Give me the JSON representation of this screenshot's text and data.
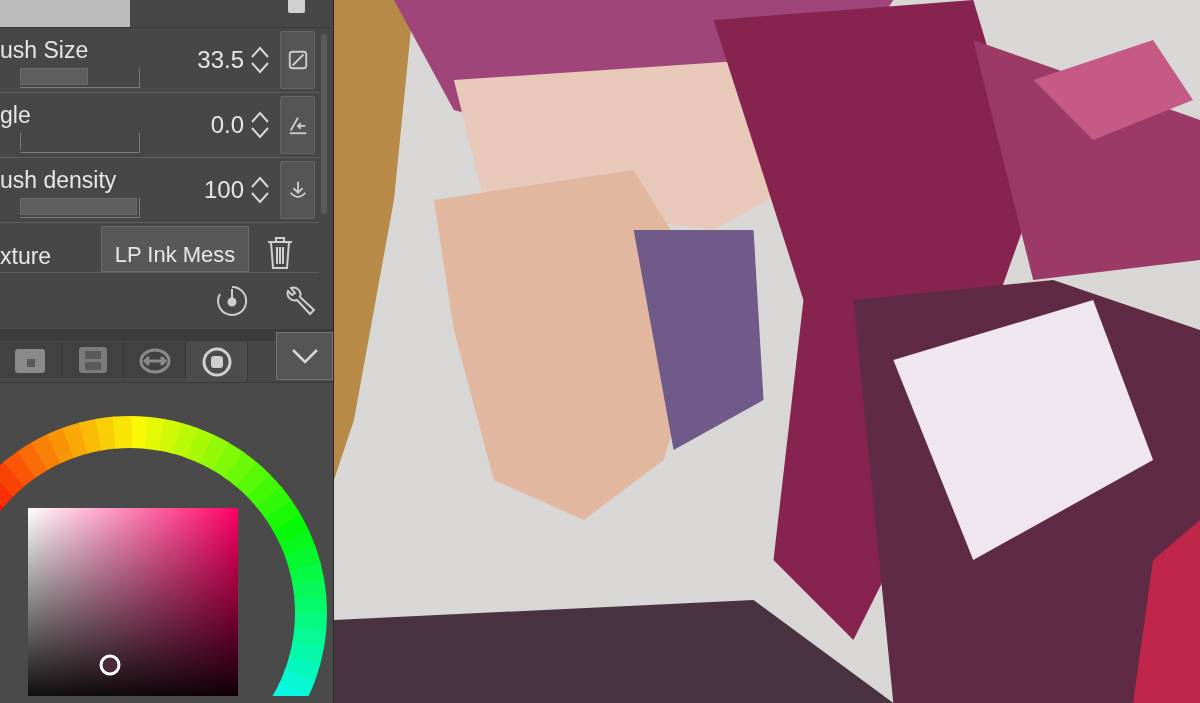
{
  "properties": [
    {
      "kind": "slider",
      "label": "ush Size",
      "value": "33.5",
      "level": 0.58
    },
    {
      "kind": "slider",
      "label": "gle",
      "value": "0.0",
      "level": 0
    },
    {
      "kind": "slider",
      "label": "ush density",
      "value": "100",
      "level": 1
    },
    {
      "kind": "texture",
      "label": "xture",
      "value": "LP Ink Mess"
    }
  ],
  "palette_tabs": [
    {
      "selected": false
    },
    {
      "selected": false
    },
    {
      "selected": false
    },
    {
      "selected": true
    }
  ]
}
